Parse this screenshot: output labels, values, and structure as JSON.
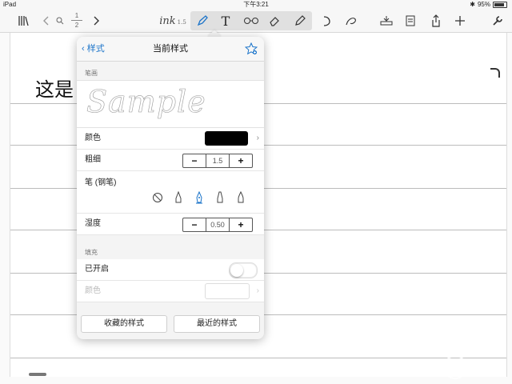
{
  "status_bar": {
    "device": "iPad",
    "time": "下午3:21",
    "battery": "95%"
  },
  "toolbar": {
    "page_current": "1",
    "page_total": "2",
    "pen_preview": "ink",
    "pen_size": "1.5",
    "text_tool_label": "T",
    "icons": [
      "library-icon",
      "back-arrow-icon",
      "search-icon",
      "forward-arrow-icon",
      "pen-icon",
      "text-icon",
      "glasses-icon",
      "eraser-icon",
      "highlighter-icon",
      "undo-icon",
      "lasso-icon",
      "insert-icon",
      "export-doc-icon",
      "share-icon",
      "add-icon",
      "wrench-icon"
    ]
  },
  "note": {
    "handwriting": "这是"
  },
  "popover": {
    "back_label": "样式",
    "title": "当前样式",
    "stroke_section": "笔画",
    "sample_text": "Sample",
    "color_label": "颜色",
    "color_value": "#000000",
    "thickness_label": "粗细",
    "thickness_value": "1.5",
    "pen_label": "笔 (钢笔)",
    "pen_types": [
      "none",
      "ballpoint",
      "fountain",
      "felt",
      "brush"
    ],
    "pen_selected": "fountain",
    "wetness_label": "湿度",
    "wetness_value": "0.50",
    "fill_section": "填充",
    "fill_enabled_label": "已开启",
    "fill_enabled": false,
    "fill_color_label": "颜色",
    "favorites_button": "收藏的样式",
    "recent_button": "最近的样式"
  },
  "watermark": {
    "glyph": "π",
    "text": "少数派",
    "sub": "SSPAI.COM"
  },
  "colors": {
    "accent": "#1a73c9",
    "toolbar_bg": "#f7f7f7",
    "rule_line": "#bcbcbc"
  }
}
